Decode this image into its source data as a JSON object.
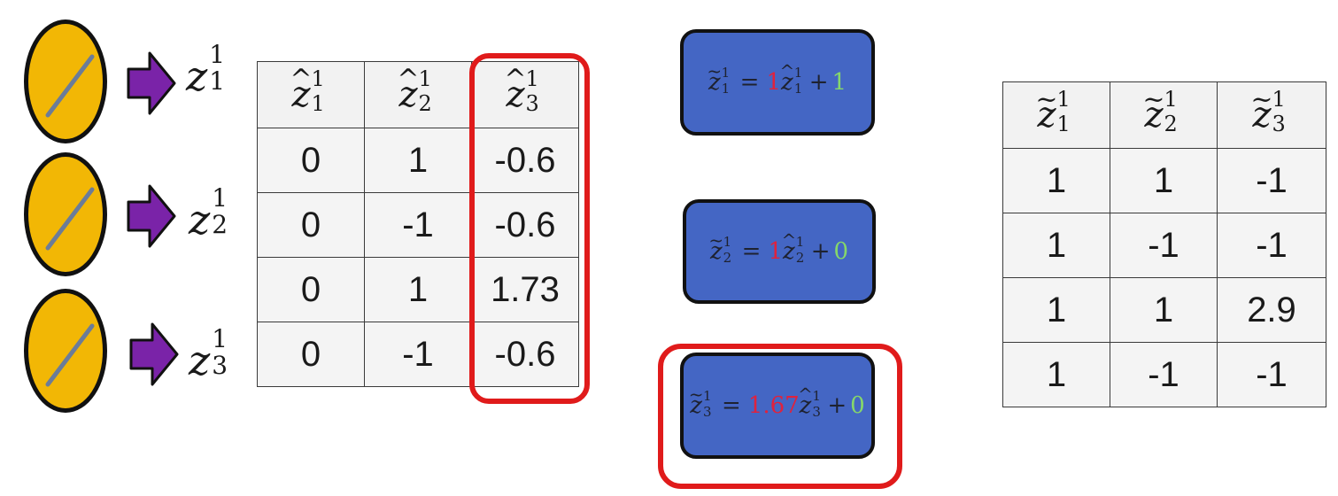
{
  "colors": {
    "neuron_fill": "#f2b705",
    "arrow_fill": "#7a23a8",
    "highlight": "#e01b1b",
    "eqbox_fill": "#4466c4",
    "weight_color": "#e0223d",
    "bias_color": "#86d86a"
  },
  "neurons": [
    {
      "icon": "linear-activation-icon",
      "label": {
        "base": "z",
        "sup": "1",
        "sub": "1"
      }
    },
    {
      "icon": "linear-activation-icon",
      "label": {
        "base": "z",
        "sup": "1",
        "sub": "2"
      }
    },
    {
      "icon": "linear-activation-icon",
      "label": {
        "base": "z",
        "sup": "1",
        "sub": "3"
      }
    }
  ],
  "normalized_table": {
    "headers": [
      {
        "base": "z",
        "accent": "^",
        "sup": "1",
        "sub": "1"
      },
      {
        "base": "z",
        "accent": "^",
        "sup": "1",
        "sub": "2"
      },
      {
        "base": "z",
        "accent": "^",
        "sup": "1",
        "sub": "3"
      }
    ],
    "rows": [
      [
        "0",
        "1",
        "-0.6"
      ],
      [
        "0",
        "-1",
        "-0.6"
      ],
      [
        "0",
        "1",
        "1.73"
      ],
      [
        "0",
        "-1",
        "-0.6"
      ]
    ]
  },
  "equations": [
    {
      "lhs": {
        "base": "z",
        "accent": "~",
        "sup": "1",
        "sub": "1"
      },
      "eq": "=",
      "weight": "1",
      "rhs": {
        "base": "z",
        "accent": "^",
        "sup": "1",
        "sub": "1"
      },
      "plus": "+",
      "bias": "1"
    },
    {
      "lhs": {
        "base": "z",
        "accent": "~",
        "sup": "1",
        "sub": "2"
      },
      "eq": "=",
      "weight": "1",
      "rhs": {
        "base": "z",
        "accent": "^",
        "sup": "1",
        "sub": "2"
      },
      "plus": "+",
      "bias": "0"
    },
    {
      "lhs": {
        "base": "z",
        "accent": "~",
        "sup": "1",
        "sub": "3"
      },
      "eq": "=",
      "weight": "1.67",
      "rhs": {
        "base": "z",
        "accent": "^",
        "sup": "1",
        "sub": "3"
      },
      "plus": "+",
      "bias": "0"
    }
  ],
  "scaled_table": {
    "headers": [
      {
        "base": "z",
        "accent": "~",
        "sup": "1",
        "sub": "1"
      },
      {
        "base": "z",
        "accent": "~",
        "sup": "1",
        "sub": "2"
      },
      {
        "base": "z",
        "accent": "~",
        "sup": "1",
        "sub": "3"
      }
    ],
    "rows": [
      [
        "1",
        "1",
        "-1"
      ],
      [
        "1",
        "-1",
        "-1"
      ],
      [
        "1",
        "1",
        "2.9"
      ],
      [
        "1",
        "-1",
        "-1"
      ]
    ]
  }
}
